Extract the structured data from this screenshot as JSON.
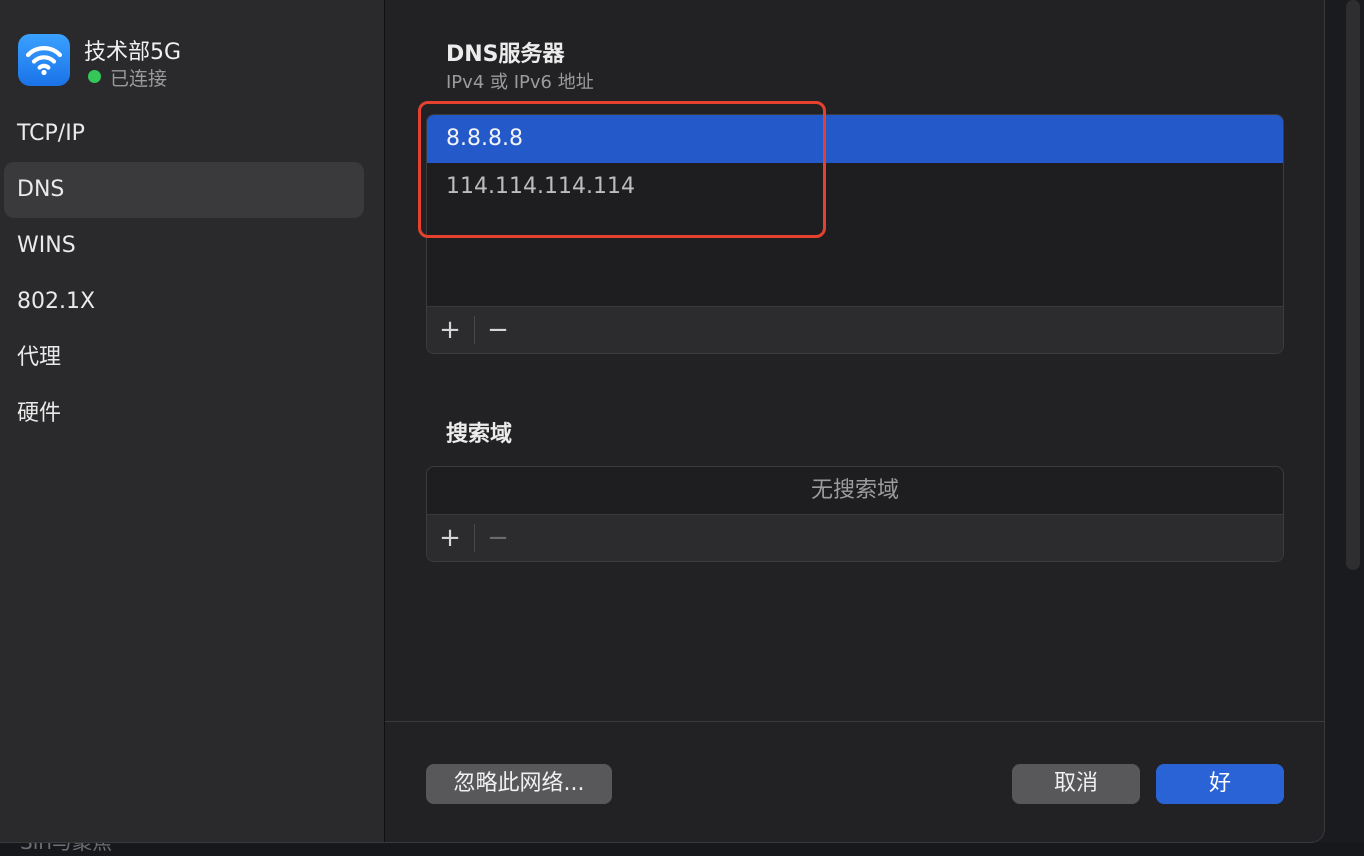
{
  "sidebar": {
    "network_name": "技术部5G",
    "status": "已连接",
    "items": [
      {
        "label": "TCP/IP"
      },
      {
        "label": "DNS"
      },
      {
        "label": "WINS"
      },
      {
        "label": "802.1X"
      },
      {
        "label": "代理"
      },
      {
        "label": "硬件"
      }
    ],
    "active_index": 1
  },
  "dns": {
    "title": "DNS服务器",
    "subtitle": "IPv4 或 IPv6 地址",
    "servers": [
      "8.8.8.8",
      "114.114.114.114"
    ],
    "selected_server": "8.8.8.8",
    "add_label": "+",
    "remove_label": "−"
  },
  "search_domains": {
    "title": "搜索域",
    "empty_text": "无搜索域",
    "add_label": "+",
    "remove_label": "−"
  },
  "buttons": {
    "forget": "忽略此网络...",
    "cancel": "取消",
    "ok": "好"
  },
  "background": {
    "partial_text": "Siri与聚焦"
  },
  "colors": {
    "accent": "#2a63d6",
    "selection": "#2459c9",
    "connected": "#35c759",
    "annotation": "#e4422f"
  },
  "icons": {
    "wifi": "wifi-icon",
    "add": "plus-icon",
    "remove": "minus-icon"
  }
}
